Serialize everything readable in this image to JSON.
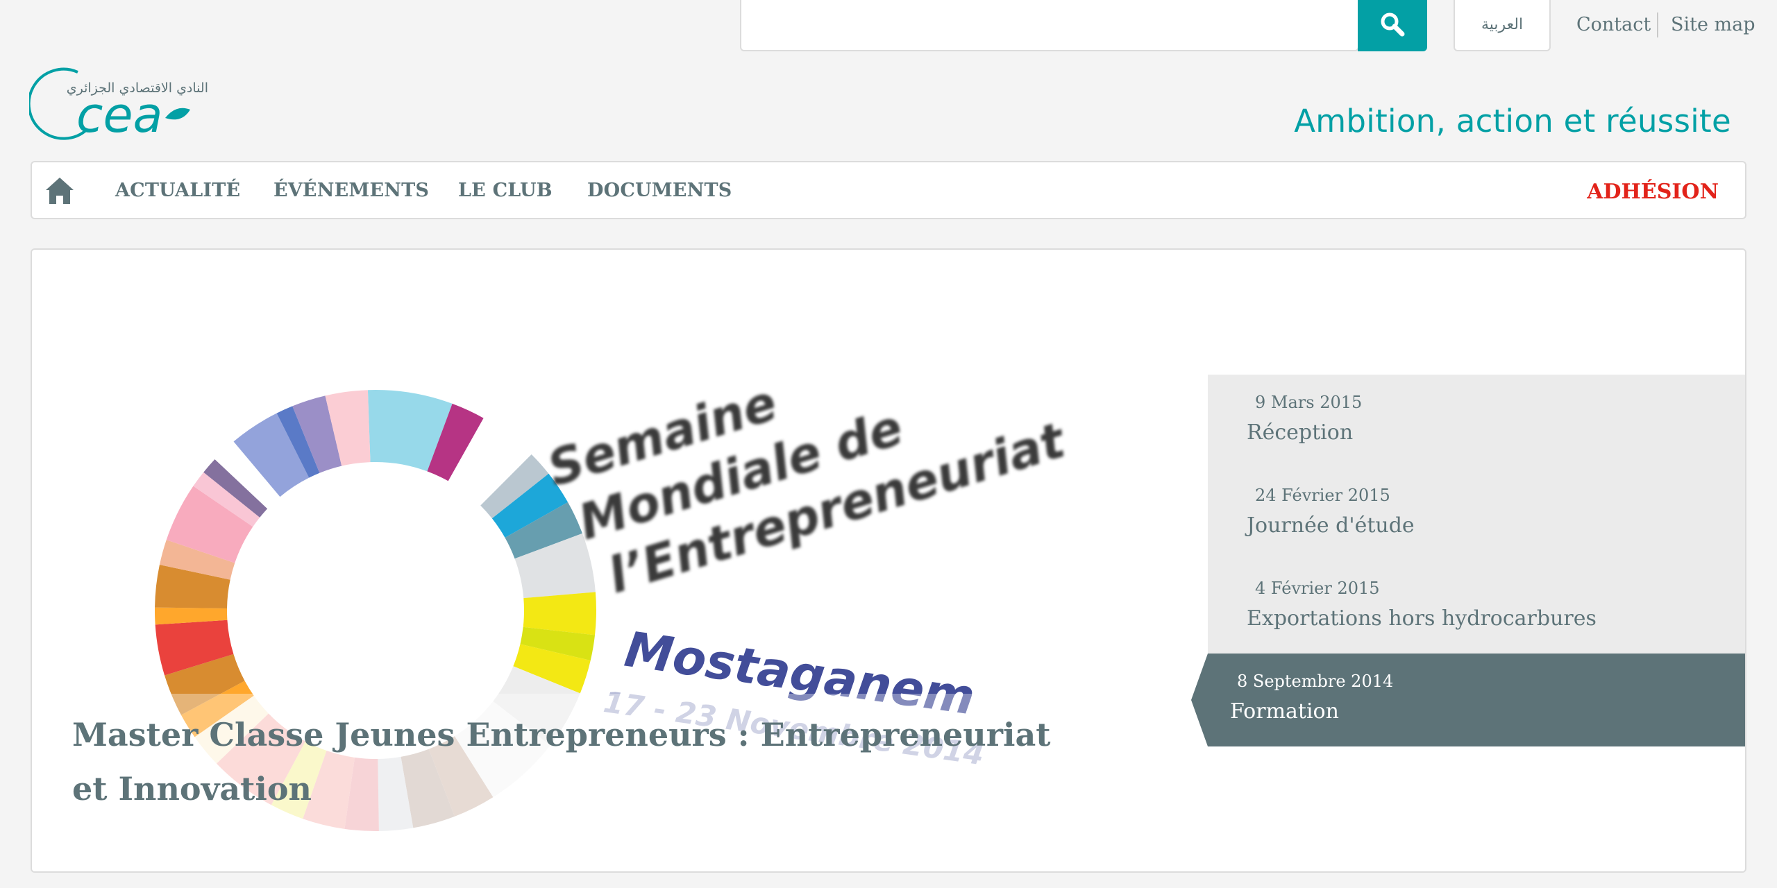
{
  "search": {
    "placeholder": "",
    "value": ""
  },
  "header": {
    "language_label": "العربية",
    "links": [
      "Contact",
      "Site map"
    ],
    "logo_arabic": "النادي الاقتصادي الجزائري",
    "logo_letters": "cea",
    "tagline": "Ambition, action et réussite"
  },
  "nav": {
    "items": [
      "ACTUALITÉ",
      "ÉVÉNEMENTS",
      "LE CLUB",
      "DOCUMENTS"
    ],
    "adhesion": "ADHÉSION"
  },
  "hero": {
    "image_text": {
      "line1": "Semaine",
      "line2": "Mondiale de",
      "line3": "l’Entrepreneuriat",
      "city": "Mostaganem",
      "dates": "17 - 23 Novembre 2014"
    },
    "title": "Master Classe Jeunes Entrepreneurs : Entrepreneuriat et Innovation"
  },
  "events": [
    {
      "date": "9 Mars 2015",
      "title": "Réception",
      "active": false
    },
    {
      "date": "24 Février 2015",
      "title": "Journée d'étude",
      "active": false
    },
    {
      "date": "4 Février 2015",
      "title": "Exportations hors hydrocarbures",
      "active": false
    },
    {
      "date": "8 Septembre 2014",
      "title": "Formation",
      "active": true
    }
  ],
  "colors": {
    "accent": "#03a0a5",
    "text": "#5d7378",
    "adhesion": "#e2231a",
    "active_event_bg": "#5d7378",
    "background": "#f4f4f4"
  }
}
